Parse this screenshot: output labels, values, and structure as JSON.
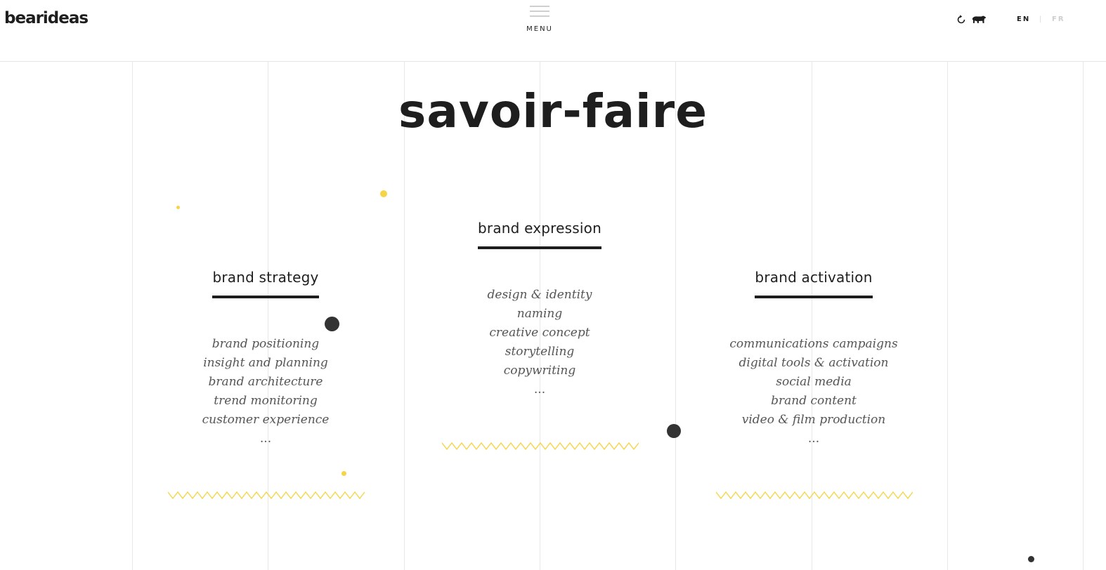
{
  "header": {
    "logo": "bearideas",
    "menu_label": "MENU",
    "lang_en": "EN",
    "lang_sep": "|",
    "lang_fr": "FR"
  },
  "title": "savoir-faire",
  "columns": [
    {
      "heading": "brand strategy",
      "items": [
        "brand positioning",
        "insight and planning",
        "brand architecture",
        "trend monitoring",
        "customer experience",
        "..."
      ]
    },
    {
      "heading": "brand expression",
      "items": [
        "design & identity",
        "naming",
        "creative concept",
        "storytelling",
        "copywriting",
        "..."
      ]
    },
    {
      "heading": "brand activation",
      "items": [
        "communications campaigns",
        "digital tools & activation",
        "social media",
        "brand content",
        "video & film production",
        "..."
      ]
    }
  ],
  "colors": {
    "accent": "#f5d547",
    "text": "#1e1e1e",
    "dot_dark": "#333333",
    "gridline": "#e8e8e8"
  },
  "icons": [
    "refresh-icon",
    "bear-icon",
    "hamburger-icon"
  ]
}
